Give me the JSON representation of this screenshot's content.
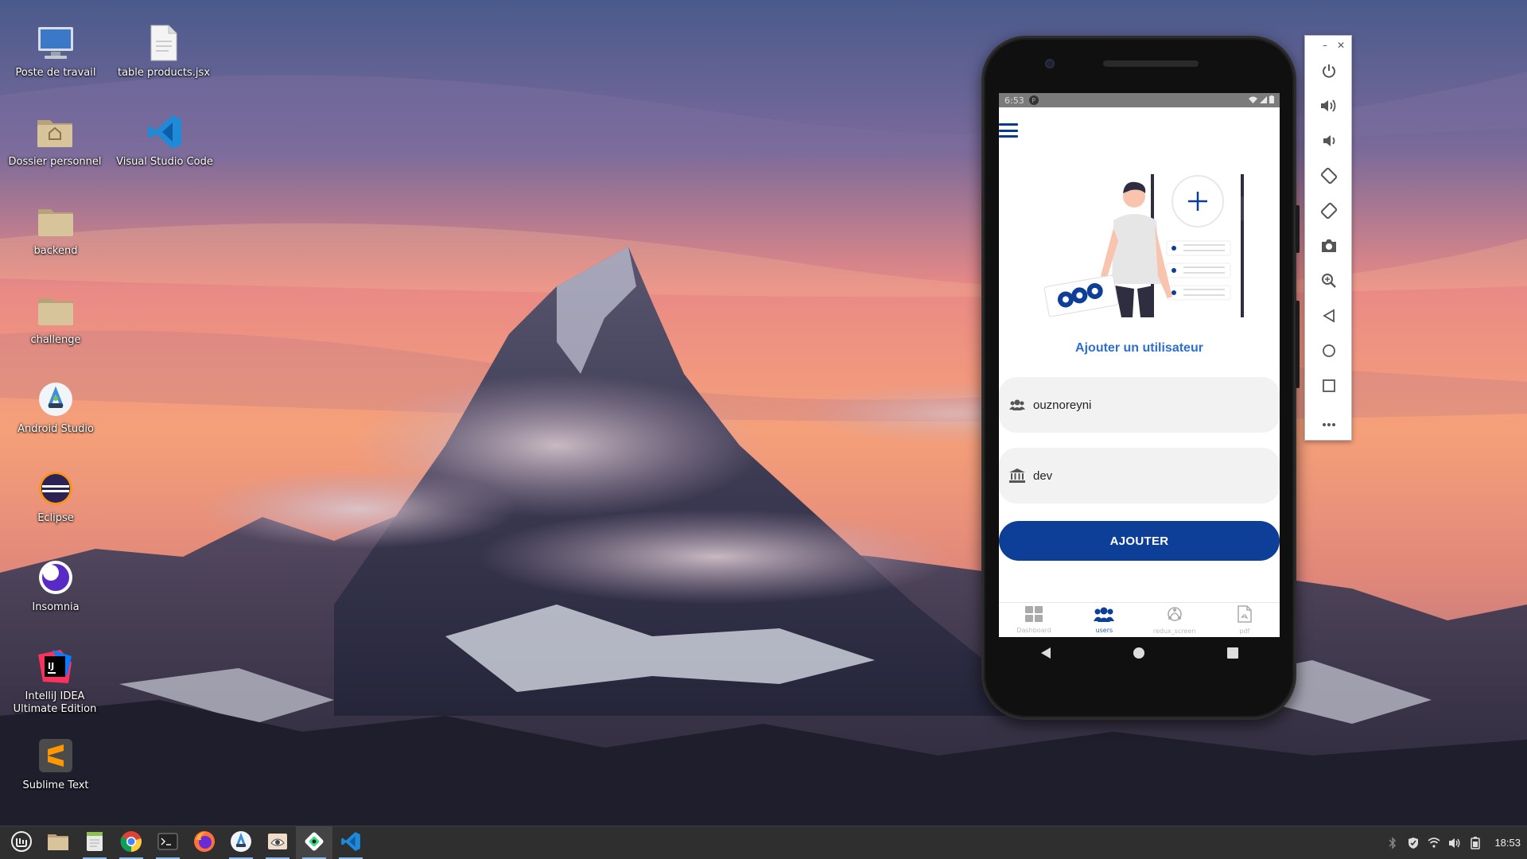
{
  "desktop": {
    "icons": [
      {
        "label": "Poste de travail",
        "icon": "computer-icon"
      },
      {
        "label": "table products.jsx",
        "icon": "document-icon"
      },
      {
        "label": "Dossier personnel",
        "icon": "home-folder-icon"
      },
      {
        "label": "Visual Studio Code",
        "icon": "vscode-icon"
      },
      {
        "label": "backend",
        "icon": "folder-icon"
      },
      {
        "label": "challenge",
        "icon": "folder-icon"
      },
      {
        "label": "Android Studio",
        "icon": "android-studio-icon"
      },
      {
        "label": "Eclipse",
        "icon": "eclipse-icon"
      },
      {
        "label": "Insomnia",
        "icon": "insomnia-icon"
      },
      {
        "label": "IntelliJ IDEA Ultimate Edition",
        "icon": "intellij-icon"
      },
      {
        "label": "Sublime Text",
        "icon": "sublime-icon"
      }
    ]
  },
  "phone": {
    "status_time": "6:53",
    "app": {
      "title": "Ajouter un utilisateur",
      "fields": {
        "username_value": "ouznoreyni",
        "department_value": "dev"
      },
      "add_button_label": "AJOUTER",
      "tabs": [
        {
          "label": "Dashboard",
          "icon": "dashboard-grid-icon",
          "active": false
        },
        {
          "label": "users",
          "icon": "users-icon",
          "active": true
        },
        {
          "label": "redux_screen",
          "icon": "redux-icon",
          "active": false
        },
        {
          "label": "pdf",
          "icon": "pdf-icon",
          "active": false
        }
      ],
      "accent_color": "#0d3f99",
      "title_color": "#2d6ed1"
    }
  },
  "emulator_toolbar": {
    "buttons": [
      "power-icon",
      "volume-up-icon",
      "volume-down-icon",
      "rotate-left-icon",
      "rotate-right-icon",
      "camera-icon",
      "zoom-icon",
      "back-icon",
      "home-icon",
      "overview-icon",
      "more-icon"
    ]
  },
  "taskbar": {
    "clock": "18:53",
    "apps": [
      "mint-menu-icon",
      "files-icon",
      "text-editor-icon",
      "chrome-icon",
      "terminal-icon",
      "firefox-icon",
      "android-studio-icon",
      "inspector-icon",
      "emulator-icon",
      "vscode-icon"
    ]
  }
}
